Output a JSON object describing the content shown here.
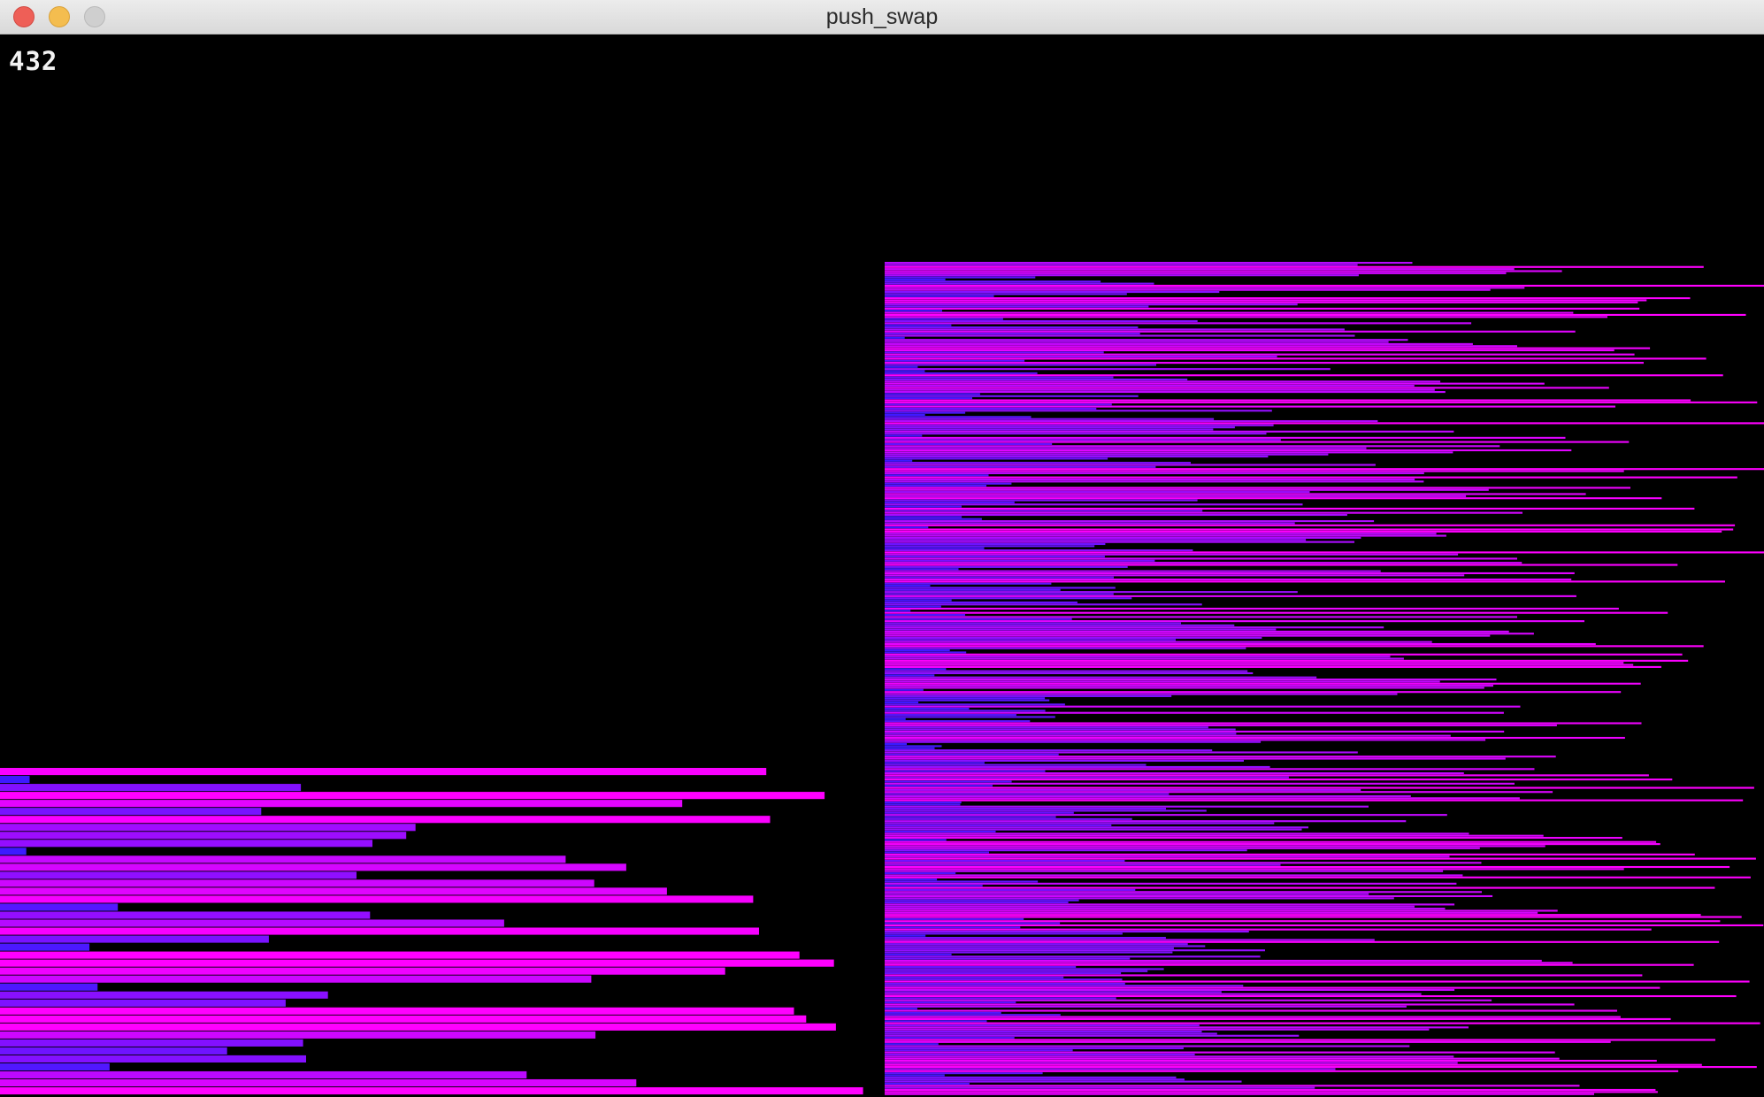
{
  "window": {
    "title": "push_swap"
  },
  "operation_count": "432",
  "colors": {
    "low": "#3a1aff",
    "high": "#ff00ff",
    "background": "#000000"
  },
  "visualization": {
    "stack_a": {
      "count": 400
    },
    "stack_b": {
      "count": 41
    },
    "seed": 42
  }
}
